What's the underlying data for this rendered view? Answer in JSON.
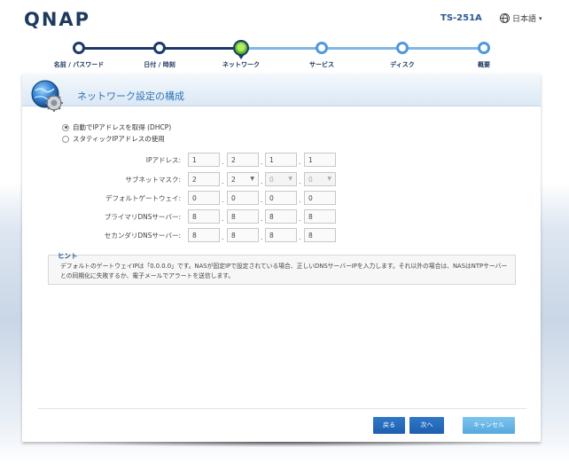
{
  "brand": {
    "logo": "QNAP",
    "model": "TS-251A",
    "language": "日本語",
    "language_arrow": "▾"
  },
  "steps": [
    {
      "label": "名前 / パスワード",
      "state": "done"
    },
    {
      "label": "日付 / 時刻",
      "state": "done"
    },
    {
      "label": "ネットワーク",
      "state": "current"
    },
    {
      "label": "サービス",
      "state": "todo"
    },
    {
      "label": "ディスク",
      "state": "todo"
    },
    {
      "label": "概要",
      "state": "todo"
    }
  ],
  "page": {
    "title": "ネットワーク設定の構成"
  },
  "mode": {
    "dhcp_label": "自動でIPアドレスを取得 (DHCP)",
    "static_label": "スタティックIPアドレスの使用",
    "selected": "dhcp"
  },
  "fields": {
    "ip": {
      "label": "IPアドレス:",
      "octets": [
        "1",
        "2",
        "1",
        "1"
      ]
    },
    "subnet": {
      "label": "サブネットマスク:",
      "octets": [
        "2",
        "2",
        "0",
        "0"
      ]
    },
    "gateway": {
      "label": "デフォルトゲートウェイ:",
      "octets": [
        "0",
        "0",
        "0",
        "0"
      ]
    },
    "dns1": {
      "label": "プライマリDNSサーバー:",
      "octets": [
        "8",
        "8",
        "8",
        "8"
      ]
    },
    "dns2": {
      "label": "セカンダリDNSサーバー:",
      "octets": [
        "8",
        "8",
        "8",
        "8"
      ]
    }
  },
  "separator": ".",
  "hint": {
    "title": "ヒント",
    "text": "デフォルトのゲートウェイIPは「0.0.0.0」です。NASが固定IPで設定されている場合、正しいDNSサーバーIPを入力します。それ以外の場合は、NASはNTPサーバーとの同期化に失敗するか、電子メールでアラートを送信します。"
  },
  "buttons": {
    "back": "戻る",
    "next": "次へ",
    "cancel": "キャンセル"
  },
  "colors": {
    "accent": "#2d74b8",
    "progress_done": "#1b3a6b",
    "progress_todo": "#7fb6e6",
    "current_step": "#53b51d"
  }
}
